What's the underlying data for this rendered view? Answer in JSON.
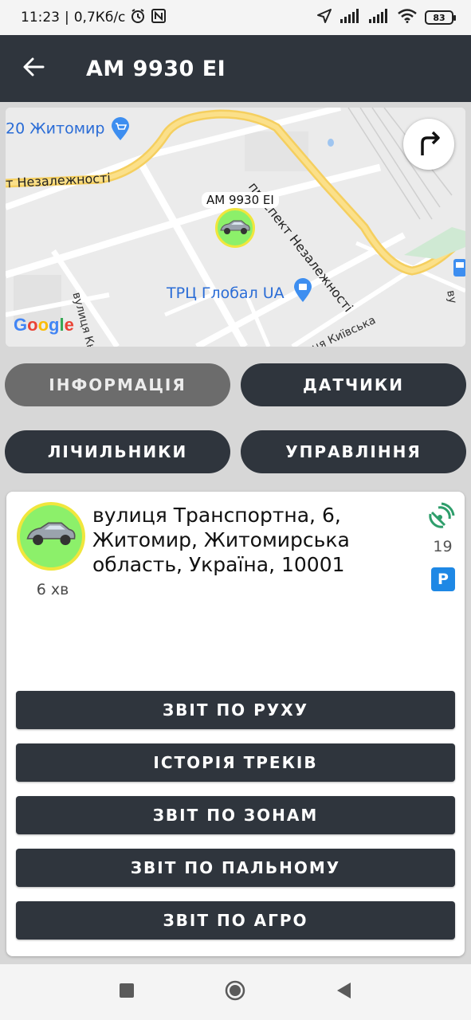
{
  "status_bar": {
    "time": "11:23",
    "separator": "|",
    "speed": "0,7Кб/с",
    "battery": "83",
    "icons": [
      "alarm-icon",
      "nfc-icon",
      "location-arrow-icon",
      "signal-icon",
      "signal-icon",
      "wifi-icon",
      "battery-icon"
    ]
  },
  "app_bar": {
    "title": "AM 9930 EI",
    "back_icon": "arrow-left-icon",
    "color": "#2f353d"
  },
  "map": {
    "labels": {
      "place_top_left": "20 Житомир",
      "street_nezalezhnosti_left": "т Незалежності",
      "street_nezalezhnosti_right": "проспект Незалежності",
      "mall": "ТРЦ Глобал UA",
      "street_kyivska": "улиця Київська",
      "street_kn": "вулиця Кн",
      "street_edge": "ву"
    },
    "marker_label": "AM 9930 EI",
    "google": "Google",
    "directions_icon": "turn-right-arrow-icon"
  },
  "tabs": [
    {
      "label": "ІНФОРМАЦІЯ",
      "active": true
    },
    {
      "label": "ДАТЧИКИ",
      "active": false
    },
    {
      "label": "ЛІЧИЛЬНИКИ",
      "active": false
    },
    {
      "label": "УПРАВЛІННЯ",
      "active": false
    }
  ],
  "info": {
    "address": "вулиця Транспортна, 6, Житомир, Житомирська область, Україна, 10001",
    "time_ago": "6 хв",
    "satellites": "19",
    "parking_badge": "P",
    "gps_icon": "satellite-icon",
    "status_colors": {
      "online": "#8cf06a",
      "ring": "#f0e63c",
      "gps": "#2e9e6b",
      "parking": "#1e88e5"
    }
  },
  "reports": [
    {
      "label": "ЗВІТ ПО РУХУ"
    },
    {
      "label": "ІСТОРІЯ ТРЕКІВ"
    },
    {
      "label": "ЗВІТ ПО ЗОНАМ"
    },
    {
      "label": "ЗВІТ ПО ПАЛЬНОМУ"
    },
    {
      "label": "ЗВІТ ПО АГРО"
    }
  ],
  "nav_bar": {
    "icons": [
      "square-recents-icon",
      "circle-home-icon",
      "triangle-back-icon"
    ]
  }
}
